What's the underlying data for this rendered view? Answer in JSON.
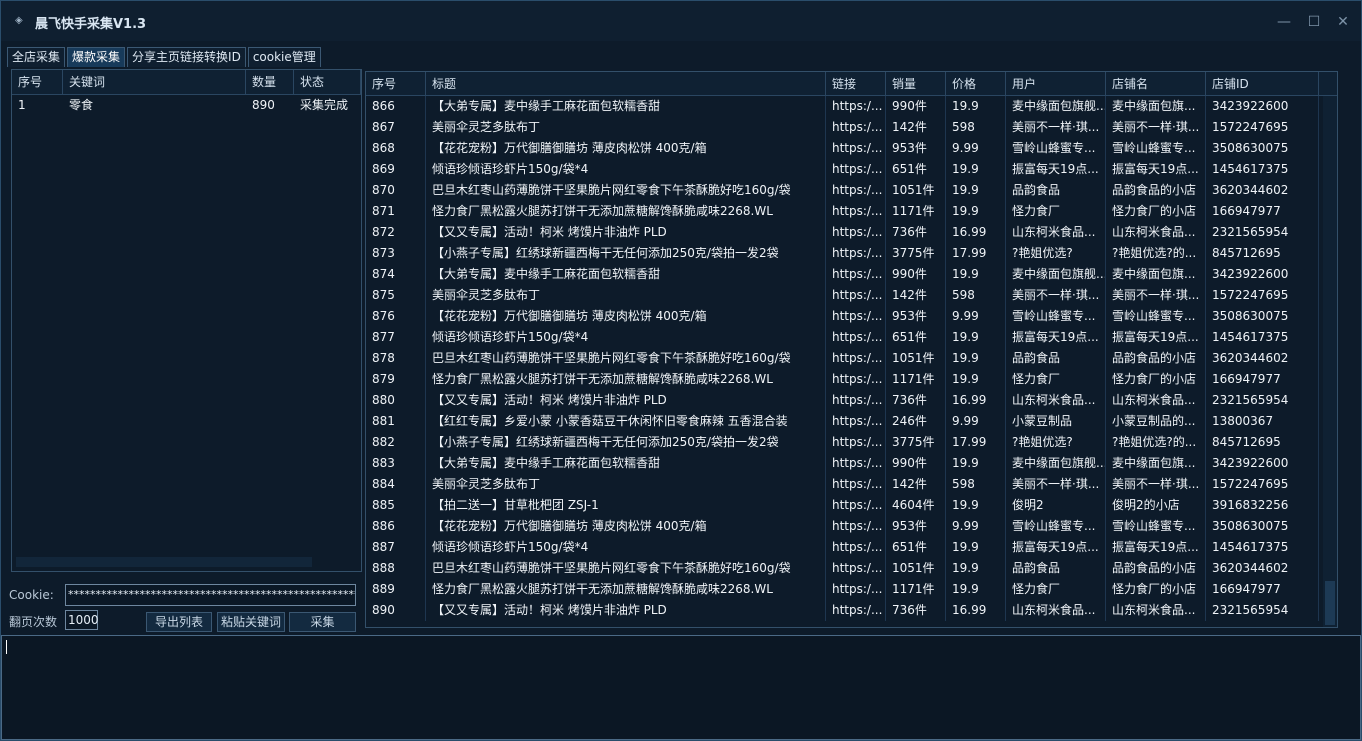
{
  "window": {
    "title": "晨飞快手采集V1.3",
    "min_icon": "minimize-icon",
    "max_icon": "maximize-icon",
    "close_icon": "close-icon"
  },
  "tabs": [
    {
      "label": "全店采集",
      "active": false
    },
    {
      "label": "爆款采集",
      "active": true
    },
    {
      "label": "分享主页链接转换ID",
      "active": false
    },
    {
      "label": "cookie管理",
      "active": false
    }
  ],
  "keyword_table": {
    "columns": [
      "序号",
      "关键词",
      "数量",
      "状态"
    ],
    "rows": [
      [
        "1",
        "零食",
        "890",
        "采集完成"
      ]
    ]
  },
  "controls": {
    "cookie_label": "Cookie:",
    "cookie_value": "************************************************************",
    "pages_label": "翻页次数",
    "pages_value": "1000",
    "export_button": "导出列表",
    "paste_button": "粘贴关键词",
    "collect_button": "采集"
  },
  "results_table": {
    "columns": [
      "序号",
      "标题",
      "链接",
      "销量",
      "价格",
      "用户",
      "店铺名",
      "店铺ID"
    ],
    "rows": [
      [
        "866",
        "【大弟专属】麦中缘手工麻花面包软糯香甜",
        "https:/...",
        "990件",
        "19.9",
        "麦中缘面包旗舰...",
        "麦中缘面包旗...",
        "3423922600"
      ],
      [
        "867",
        "美丽伞灵芝多肽布丁",
        "https:/...",
        "142件",
        "598",
        "美丽不一样·琪...",
        "美丽不一样·琪...",
        "1572247695"
      ],
      [
        "868",
        "【花花宠粉】万代御膳御膳坊 薄皮肉松饼 400克/箱",
        "https:/...",
        "953件",
        "9.99",
        "雪岭山蜂蜜专...",
        "雪岭山蜂蜜专...",
        "3508630075"
      ],
      [
        "869",
        "倾语珍倾语珍虾片150g/袋*4",
        "https:/...",
        "651件",
        "19.9",
        "振富每天19点...",
        "振富每天19点...",
        "1454617375"
      ],
      [
        "870",
        "巴旦木红枣山药薄脆饼干坚果脆片网红零食下午茶酥脆好吃160g/袋",
        "https:/...",
        "1051件",
        "19.9",
        "品韵食品",
        "品韵食品的小店",
        "3620344602"
      ],
      [
        "871",
        "怪力食厂黑松露火腿苏打饼干无添加蔗糖解馋酥脆咸味2268.WL",
        "https:/...",
        "1171件",
        "19.9",
        "怪力食厂",
        "怪力食厂的小店",
        "166947977"
      ],
      [
        "872",
        "【又又专属】活动！柯米 烤馍片非油炸 PLD",
        "https:/...",
        "736件",
        "16.99",
        "山东柯米食品...",
        "山东柯米食品...",
        "2321565954"
      ],
      [
        "873",
        "【小燕子专属】红绣球新疆西梅干无任何添加250克/袋拍一发2袋",
        "https:/...",
        "3775件",
        "17.99",
        "?艳姐优选?",
        "?艳姐优选?的...",
        "845712695"
      ],
      [
        "874",
        "【大弟专属】麦中缘手工麻花面包软糯香甜",
        "https:/...",
        "990件",
        "19.9",
        "麦中缘面包旗舰...",
        "麦中缘面包旗...",
        "3423922600"
      ],
      [
        "875",
        "美丽伞灵芝多肽布丁",
        "https:/...",
        "142件",
        "598",
        "美丽不一样·琪...",
        "美丽不一样·琪...",
        "1572247695"
      ],
      [
        "876",
        "【花花宠粉】万代御膳御膳坊 薄皮肉松饼 400克/箱",
        "https:/...",
        "953件",
        "9.99",
        "雪岭山蜂蜜专...",
        "雪岭山蜂蜜专...",
        "3508630075"
      ],
      [
        "877",
        "倾语珍倾语珍虾片150g/袋*4",
        "https:/...",
        "651件",
        "19.9",
        "振富每天19点...",
        "振富每天19点...",
        "1454617375"
      ],
      [
        "878",
        "巴旦木红枣山药薄脆饼干坚果脆片网红零食下午茶酥脆好吃160g/袋",
        "https:/...",
        "1051件",
        "19.9",
        "品韵食品",
        "品韵食品的小店",
        "3620344602"
      ],
      [
        "879",
        "怪力食厂黑松露火腿苏打饼干无添加蔗糖解馋酥脆咸味2268.WL",
        "https:/...",
        "1171件",
        "19.9",
        "怪力食厂",
        "怪力食厂的小店",
        "166947977"
      ],
      [
        "880",
        "【又又专属】活动！柯米 烤馍片非油炸 PLD",
        "https:/...",
        "736件",
        "16.99",
        "山东柯米食品...",
        "山东柯米食品...",
        "2321565954"
      ],
      [
        "881",
        "【红红专属】乡爱小蒙 小蒙香菇豆干休闲怀旧零食麻辣 五香混合装",
        "https:/...",
        "246件",
        "9.99",
        "小蒙豆制品",
        "小蒙豆制品的...",
        "13800367"
      ],
      [
        "882",
        "【小燕子专属】红绣球新疆西梅干无任何添加250克/袋拍一发2袋",
        "https:/...",
        "3775件",
        "17.99",
        "?艳姐优选?",
        "?艳姐优选?的...",
        "845712695"
      ],
      [
        "883",
        "【大弟专属】麦中缘手工麻花面包软糯香甜",
        "https:/...",
        "990件",
        "19.9",
        "麦中缘面包旗舰...",
        "麦中缘面包旗...",
        "3423922600"
      ],
      [
        "884",
        "美丽伞灵芝多肽布丁",
        "https:/...",
        "142件",
        "598",
        "美丽不一样·琪...",
        "美丽不一样·琪...",
        "1572247695"
      ],
      [
        "885",
        "【拍二送一】甘草枇杷团 ZSJ-1",
        "https:/...",
        "4604件",
        "19.9",
        "俊明2",
        "俊明2的小店",
        "3916832256"
      ],
      [
        "886",
        "【花花宠粉】万代御膳御膳坊 薄皮肉松饼 400克/箱",
        "https:/...",
        "953件",
        "9.99",
        "雪岭山蜂蜜专...",
        "雪岭山蜂蜜专...",
        "3508630075"
      ],
      [
        "887",
        "倾语珍倾语珍虾片150g/袋*4",
        "https:/...",
        "651件",
        "19.9",
        "振富每天19点...",
        "振富每天19点...",
        "1454617375"
      ],
      [
        "888",
        "巴旦木红枣山药薄脆饼干坚果脆片网红零食下午茶酥脆好吃160g/袋",
        "https:/...",
        "1051件",
        "19.9",
        "品韵食品",
        "品韵食品的小店",
        "3620344602"
      ],
      [
        "889",
        "怪力食厂黑松露火腿苏打饼干无添加蔗糖解馋酥脆咸味2268.WL",
        "https:/...",
        "1171件",
        "19.9",
        "怪力食厂",
        "怪力食厂的小店",
        "166947977"
      ],
      [
        "890",
        "【又又专属】活动！柯米 烤馍片非油炸 PLD",
        "https:/...",
        "736件",
        "16.99",
        "山东柯米食品...",
        "山东柯米食品...",
        "2321565954"
      ]
    ]
  },
  "log": {
    "text": ""
  }
}
